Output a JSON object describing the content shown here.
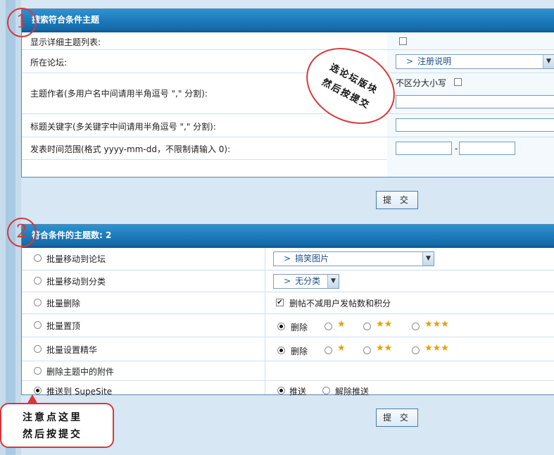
{
  "search_panel": {
    "title": "搜索符合条件主题",
    "show_detail_label": "显示详细主题列表:",
    "forum_label": "所在论坛:",
    "forum_selected": "注册说明",
    "author_label": "主题作者(多用户名中间请用半角逗号 \",\" 分割):",
    "case_insensitive_label": "不区分大小写",
    "keyword_label": "标题关键字(多关键字中间请用半角逗号 \",\" 分割):",
    "date_label": "发表时间范围(格式 yyyy-mm-dd，不限制请输入 0):",
    "date_sep": "-",
    "submit_label": "提 交"
  },
  "action_panel": {
    "title": "符合条件的主题数: 2",
    "actions": [
      {
        "label": "批量移动到论坛"
      },
      {
        "label": "批量移动到分类"
      },
      {
        "label": "批量删除"
      },
      {
        "label": "批量置顶"
      },
      {
        "label": "批量设置精华"
      },
      {
        "label": "删除主题中的附件"
      },
      {
        "label": "推送到  SupeSite"
      }
    ],
    "move_forum_selected": "搞笑图片",
    "move_category_selected": "无分类",
    "delete_option_label": "删帖不减用户发帖数和积分",
    "top_options": {
      "delete": "删除"
    },
    "digest_options": {
      "delete": "删除"
    },
    "push_label": "推送",
    "unpush_label": "解除推送",
    "submit_label": "提 交"
  },
  "annotations": {
    "step1": "1",
    "step2": "2",
    "bubble1_line1": "选论坛版块",
    "bubble1_line2": "然后按提交",
    "bubble2_line1": "注意点这里",
    "bubble2_line2": "然后按提交"
  },
  "colors": {
    "header": "#1b78b8",
    "accent_red": "#d8373a",
    "background": "#d7e7f4"
  }
}
